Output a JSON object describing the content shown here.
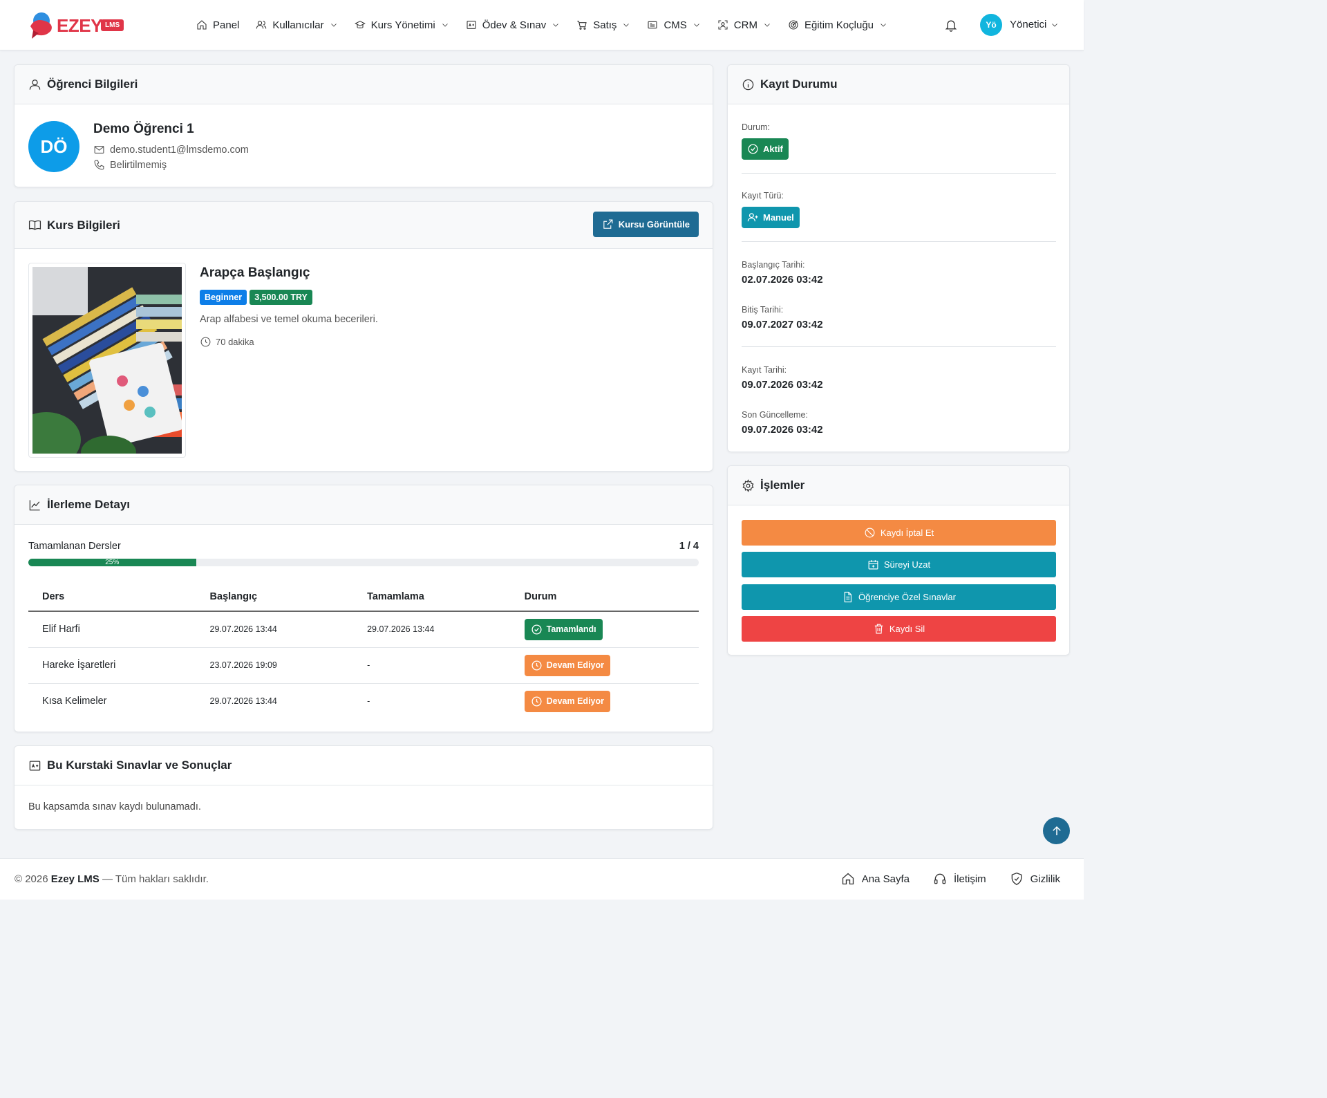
{
  "brand": {
    "name": "EZEY",
    "badge": "LMS"
  },
  "nav": [
    {
      "label": "Panel",
      "icon": "home-icon",
      "dropdown": false
    },
    {
      "label": "Kullanıcılar",
      "icon": "users-icon",
      "dropdown": true
    },
    {
      "label": "Kurs Yönetimi",
      "icon": "graduation-cap-icon",
      "dropdown": true
    },
    {
      "label": "Ödev & Sınav",
      "icon": "exam-icon",
      "dropdown": true
    },
    {
      "label": "Satış",
      "icon": "cart-icon",
      "dropdown": true
    },
    {
      "label": "CMS",
      "icon": "cms-icon",
      "dropdown": true
    },
    {
      "label": "CRM",
      "icon": "crm-icon",
      "dropdown": true
    },
    {
      "label": "Eğitim Koçluğu",
      "icon": "target-icon",
      "dropdown": true
    }
  ],
  "user": {
    "initials": "Yö",
    "name": "Yönetici"
  },
  "student": {
    "header": "Öğrenci Bilgileri",
    "initials": "DÖ",
    "name": "Demo Öğrenci 1",
    "email": "demo.student1@lmsdemo.com",
    "phone": "Belirtilmemiş"
  },
  "course": {
    "header": "Kurs Bilgileri",
    "view_button": "Kursu Görüntüle",
    "title": "Arapça Başlangıç",
    "level": "Beginner",
    "price": "3,500.00 TRY",
    "description": "Arap alfabesi ve temel okuma becerileri.",
    "duration": "70 dakika"
  },
  "progress": {
    "header": "İlerleme Detayı",
    "label": "Tamamlanan Dersler",
    "count": "1 / 4",
    "percent": 25,
    "percent_label": "25%",
    "columns": [
      "Ders",
      "Başlangıç",
      "Tamamlama",
      "Durum"
    ],
    "rows": [
      {
        "lesson": "Elif Harfi",
        "start": "29.07.2026 13:44",
        "end": "29.07.2026 13:44",
        "status": "Tamamlandı",
        "status_type": "done"
      },
      {
        "lesson": "Hareke İşaretleri",
        "start": "23.07.2026 19:09",
        "end": "-",
        "status": "Devam Ediyor",
        "status_type": "ongoing"
      },
      {
        "lesson": "Kısa Kelimeler",
        "start": "29.07.2026 13:44",
        "end": "-",
        "status": "Devam Ediyor",
        "status_type": "ongoing"
      }
    ]
  },
  "exams": {
    "header": "Bu Kurstaki Sınavlar ve Sonuçlar",
    "empty": "Bu kapsamda sınav kaydı bulunamadı."
  },
  "enrollment": {
    "header": "Kayıt Durumu",
    "status_label": "Durum:",
    "status_value": "Aktif",
    "type_label": "Kayıt Türü:",
    "type_value": "Manuel",
    "start_label": "Başlangıç Tarihi:",
    "start_value": "02.07.2026 03:42",
    "end_label": "Bitiş Tarihi:",
    "end_value": "09.07.2027 03:42",
    "created_label": "Kayıt Tarihi:",
    "created_value": "09.07.2026 03:42",
    "updated_label": "Son Güncelleme:",
    "updated_value": "09.07.2026 03:42"
  },
  "actions": {
    "header": "İşlemler",
    "cancel": "Kaydı İptal Et",
    "extend": "Süreyi Uzat",
    "exams": "Öğrenciye Özel Sınavlar",
    "delete": "Kaydı Sil"
  },
  "footer": {
    "year": "© 2026",
    "brand": "Ezey LMS",
    "rights": "— Tüm hakları saklıdır.",
    "links": [
      "Ana Sayfa",
      "İletişim",
      "Gizlilik"
    ]
  },
  "colors": {
    "primary": "#1f6b93",
    "success": "#198754",
    "info": "#0f96ad",
    "warning": "#f48a43",
    "danger": "#ee4444",
    "blue": "#0d9ce8"
  }
}
